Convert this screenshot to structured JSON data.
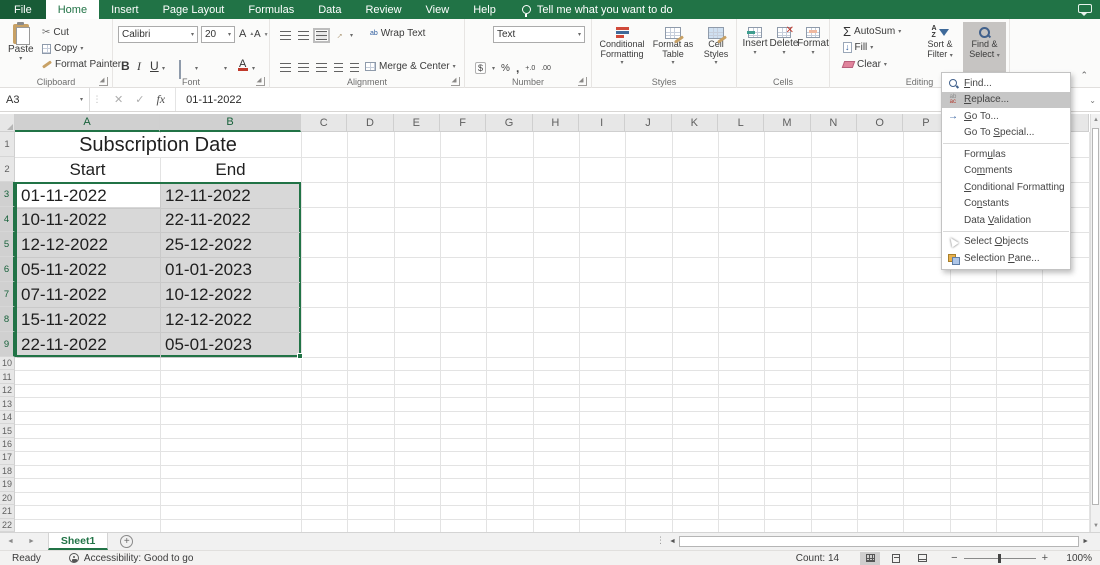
{
  "colors": {
    "excel_green": "#217346",
    "selection_fill": "#d8d8d8",
    "menu_highlight": "#c6c6c6"
  },
  "icons": {
    "chevron_down": "▾",
    "up_arrow": "▲",
    "down_arrow": "▼",
    "left_arrow": "◄",
    "right_arrow": "►",
    "check": "✓",
    "cancel": "✕",
    "scissors": "✂",
    "sigma": "Σ",
    "fill_arrow": "↓",
    "percent": "%",
    "comma": ",",
    "dollar": "$",
    "inc_decimal": "+.0",
    "dec_decimal": ".00",
    "goto_arrow": "→",
    "wrap_ab": "ab",
    "orient_arrow": "→",
    "ellipsis": "⋮",
    "collapse_chevron": "⌃",
    "expand_chevron": "⌄",
    "plus": "+",
    "minus": "−",
    "sort_a": "A",
    "sort_z": "Z",
    "replace_ab": "ab",
    "replace_ac": "ac"
  },
  "titlebar": {
    "tabs": [
      "File",
      "Home",
      "Insert",
      "Page Layout",
      "Formulas",
      "Data",
      "Review",
      "View",
      "Help"
    ],
    "tell_me": "Tell me what you want to do"
  },
  "ribbon": {
    "clipboard": {
      "label": "Clipboard",
      "paste": "Paste",
      "cut": "Cut",
      "copy": "Copy",
      "format_painter": "Format Painter"
    },
    "font": {
      "label": "Font",
      "name": "Calibri",
      "size": "20",
      "bold": "B",
      "italic": "I",
      "underline": "U",
      "grow": "A",
      "shrink": "A",
      "color_a": "A"
    },
    "alignment": {
      "label": "Alignment",
      "wrap": "Wrap Text",
      "merge": "Merge & Center"
    },
    "number": {
      "label": "Number",
      "format": "Text"
    },
    "styles": {
      "label": "Styles",
      "conditional": "Conditional Formatting",
      "format_table": "Format as Table",
      "cell_styles": "Cell Styles"
    },
    "cells": {
      "label": "Cells",
      "insert": "Insert",
      "delete": "Delete",
      "format": "Format"
    },
    "editing": {
      "label": "Editing",
      "autosum": "AutoSum",
      "fill": "Fill",
      "clear": "Clear",
      "sort_filter_1": "Sort &",
      "sort_filter_2": "Filter",
      "find_select_1": "Find &",
      "find_select_2": "Select"
    }
  },
  "formula_bar": {
    "name_box": "A3",
    "fx_label": "fx",
    "value": "01-11-2022"
  },
  "menu": {
    "items": [
      {
        "name": "find",
        "icon": "find",
        "pre": "",
        "key": "F",
        "post": "ind...",
        "highlighted": false,
        "separator_after": false
      },
      {
        "name": "replace",
        "icon": "replace",
        "pre": "",
        "key": "R",
        "post": "eplace...",
        "highlighted": true,
        "separator_after": false
      },
      {
        "name": "go-to",
        "icon": "goto",
        "pre": "",
        "key": "G",
        "post": "o To...",
        "highlighted": false,
        "separator_after": false
      },
      {
        "name": "go-to-special",
        "icon": "",
        "pre": "Go To ",
        "key": "S",
        "post": "pecial...",
        "highlighted": false,
        "separator_after": true
      },
      {
        "name": "formulas",
        "icon": "",
        "pre": "Form",
        "key": "u",
        "post": "las",
        "highlighted": false,
        "separator_after": false
      },
      {
        "name": "comments",
        "icon": "",
        "pre": "Co",
        "key": "m",
        "post": "ments",
        "highlighted": false,
        "separator_after": false
      },
      {
        "name": "conditional-formatting",
        "icon": "",
        "pre": "",
        "key": "C",
        "post": "onditional Formatting",
        "highlighted": false,
        "separator_after": false
      },
      {
        "name": "constants",
        "icon": "",
        "pre": "Co",
        "key": "n",
        "post": "stants",
        "highlighted": false,
        "separator_after": false
      },
      {
        "name": "data-validation",
        "icon": "",
        "pre": "Data ",
        "key": "V",
        "post": "alidation",
        "highlighted": false,
        "separator_after": true
      },
      {
        "name": "select-objects",
        "icon": "pointer",
        "pre": "Select ",
        "key": "O",
        "post": "bjects",
        "highlighted": false,
        "separator_after": false
      },
      {
        "name": "selection-pane",
        "icon": "pane",
        "pre": "Selection ",
        "key": "P",
        "post": "ane...",
        "highlighted": false,
        "separator_after": false
      }
    ]
  },
  "grid": {
    "columns": [
      "A",
      "B",
      "C",
      "D",
      "E",
      "F",
      "G",
      "H",
      "I",
      "J",
      "K",
      "L",
      "M",
      "N",
      "O",
      "P"
    ],
    "rows": [
      "1",
      "2",
      "3",
      "4",
      "5",
      "6",
      "7",
      "8",
      "9",
      "10",
      "11",
      "12",
      "13",
      "14",
      "15",
      "16",
      "17",
      "18",
      "19",
      "20",
      "21",
      "22"
    ],
    "selection": {
      "range": "A3:B9",
      "active_cell": "A3",
      "selected_columns": [
        "A",
        "B"
      ],
      "selected_rows": [
        "3",
        "4",
        "5",
        "6",
        "7",
        "8",
        "9"
      ]
    },
    "title": "Subscription Date",
    "column_titles": [
      "Start",
      "End"
    ],
    "data": [
      [
        "01-11-2022",
        "12-11-2022"
      ],
      [
        "10-11-2022",
        "22-11-2022"
      ],
      [
        "12-12-2022",
        "25-12-2022"
      ],
      [
        "05-11-2022",
        "01-01-2023"
      ],
      [
        "07-11-2022",
        "10-12-2022"
      ],
      [
        "15-11-2022",
        "12-12-2022"
      ],
      [
        "22-11-2022",
        "05-01-2023"
      ]
    ]
  },
  "sheet_bar": {
    "tab": "Sheet1"
  },
  "status_bar": {
    "ready": "Ready",
    "accessibility": "Accessibility: Good to go",
    "count": "Count: 14",
    "zoom_level": "100%"
  }
}
